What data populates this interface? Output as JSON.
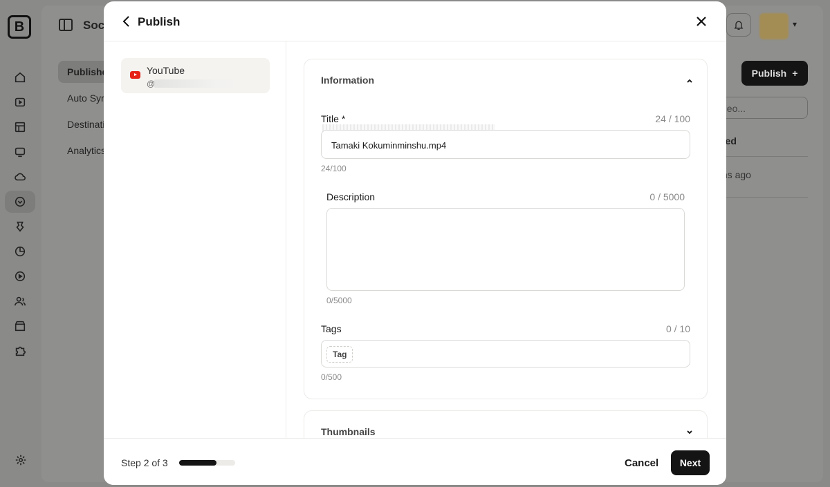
{
  "app": {
    "title": "Soci",
    "logo_letter": "B",
    "subnav": [
      "Publishe",
      "Auto Syr",
      "Destinati",
      "Analytics"
    ],
    "publish_button": "Publish",
    "search_placeholder": "deo...",
    "column_header": "hed",
    "row_time": "ths ago"
  },
  "modal": {
    "title": "Publish",
    "account": {
      "platform": "YouTube",
      "handle": "@l"
    },
    "information": {
      "title": "Information",
      "title_field": {
        "label": "Title *",
        "counter": "24 / 100",
        "value": "Tamaki Kokuminminshu.mp4",
        "sub_counter": "24/100"
      },
      "description_field": {
        "label": "Description",
        "counter": "0 / 5000",
        "value": "",
        "sub_counter": "0/5000"
      },
      "tags_field": {
        "label": "Tags",
        "counter": "0 / 10",
        "chip": "Tag",
        "sub_counter": "0/500"
      }
    },
    "thumbnails": {
      "title": "Thumbnails"
    },
    "footer": {
      "step_text": "Step 2 of 3",
      "progress": 0.667,
      "cancel_label": "Cancel",
      "next_label": "Next"
    }
  },
  "colors": {
    "accent": "#141414",
    "youtube": "#e62117",
    "overlay": "#8a8a89"
  }
}
